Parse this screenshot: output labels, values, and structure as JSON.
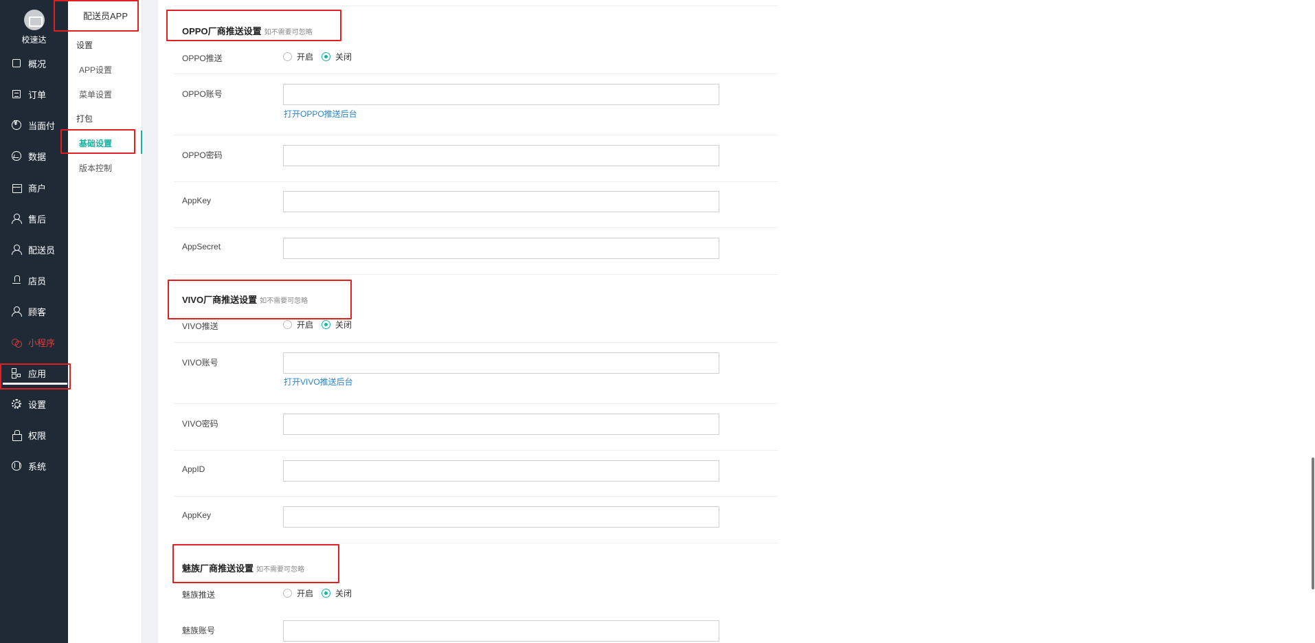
{
  "sidebar": {
    "brand_name": "校速达",
    "items": [
      {
        "label": "概况",
        "icon": "overview-icon"
      },
      {
        "label": "订单",
        "icon": "order-icon"
      },
      {
        "label": "当面付",
        "icon": "yen-icon"
      },
      {
        "label": "数据",
        "icon": "chart-icon"
      },
      {
        "label": "商户",
        "icon": "shop-icon"
      },
      {
        "label": "售后",
        "icon": "headset-icon"
      },
      {
        "label": "配送员",
        "icon": "user-icon"
      },
      {
        "label": "店员",
        "icon": "clerk-icon"
      },
      {
        "label": "顾客",
        "icon": "customer-icon"
      },
      {
        "label": "小程序",
        "icon": "mini-program-icon"
      },
      {
        "label": "应用",
        "icon": "apps-icon"
      },
      {
        "label": "设置",
        "icon": "gear-icon"
      },
      {
        "label": "权限",
        "icon": "lock-icon"
      },
      {
        "label": "系统",
        "icon": "system-icon"
      }
    ],
    "highlight_color": "#e23b3b"
  },
  "subnav": {
    "title": "配送员APP",
    "group_settings": "设置",
    "app_settings": "APP设置",
    "menu_settings": "菜单设置",
    "group_pack": "打包",
    "basic_settings": "基础设置",
    "version_control": "版本控制",
    "accent_color": "#17b3a3"
  },
  "oppo": {
    "title": "OPPO厂商推送设置",
    "hint": "如不需要可忽略",
    "push_label": "OPPO推送",
    "on_label": "开启",
    "off_label": "关闭",
    "account_label": "OPPO账号",
    "open_backend_link": "打开OPPO推送后台",
    "password_label": "OPPO密码",
    "appkey_label": "AppKey",
    "appsecret_label": "AppSecret"
  },
  "vivo": {
    "title": "VIVO厂商推送设置",
    "hint": "如不需要可忽略",
    "push_label": "VIVO推送",
    "on_label": "开启",
    "off_label": "关闭",
    "account_label": "VIVO账号",
    "open_backend_link": "打开VIVO推送后台",
    "password_label": "VIVO密码",
    "appid_label": "AppID",
    "appkey_label": "AppKey"
  },
  "meizu": {
    "title": "魅族厂商推送设置",
    "hint": "如不需要可忽略",
    "push_label": "魅族推送",
    "on_label": "开启",
    "off_label": "关闭",
    "account_label": "魅族账号"
  }
}
